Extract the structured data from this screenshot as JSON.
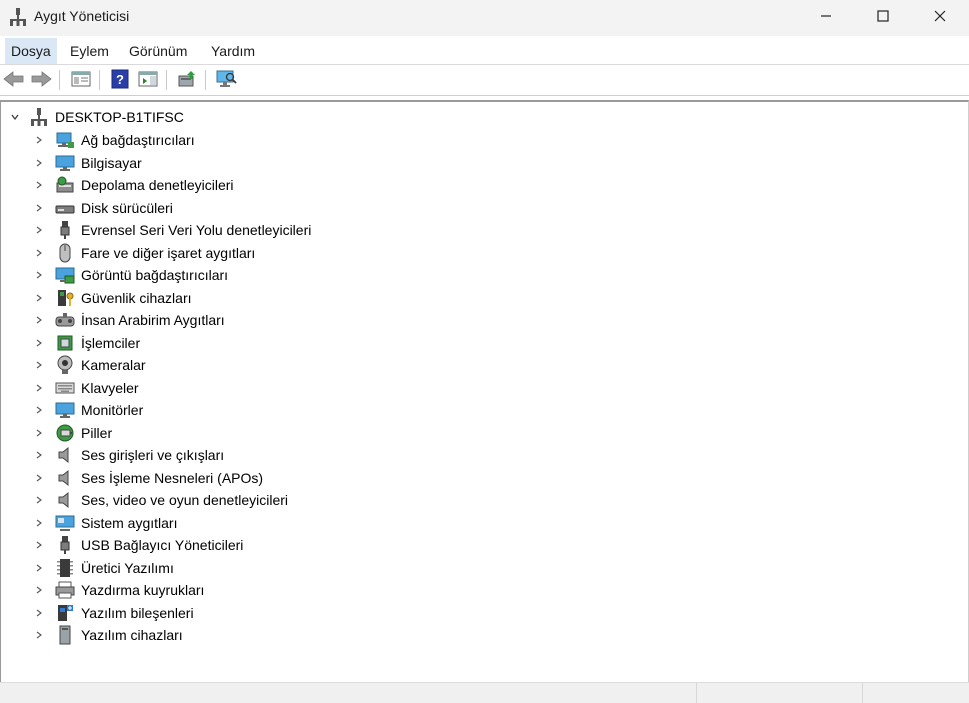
{
  "window": {
    "title": "Aygıt Yöneticisi",
    "controls": [
      "minimize-icon",
      "maximize-icon",
      "close-icon"
    ]
  },
  "menu": {
    "items": [
      "Dosya",
      "Eylem",
      "Görünüm",
      "Yardım"
    ],
    "active": "Dosya"
  },
  "toolbar": {
    "buttons": [
      "back-arrow-icon",
      "forward-arrow-icon",
      "properties-icon",
      "help-icon",
      "action-pane-icon",
      "update-driver-icon",
      "scan-hardware-icon"
    ]
  },
  "tree": {
    "root": "DESKTOP-B1TIFSC",
    "items": [
      {
        "label": "Ağ bağdaştırıcıları",
        "icon": "network-adapter-icon"
      },
      {
        "label": "Bilgisayar",
        "icon": "computer-icon"
      },
      {
        "label": "Depolama denetleyicileri",
        "icon": "storage-controller-icon"
      },
      {
        "label": "Disk sürücüleri",
        "icon": "disk-drive-icon"
      },
      {
        "label": "Evrensel Seri Veri Yolu denetleyicileri",
        "icon": "usb-connector-icon"
      },
      {
        "label": "Fare ve diğer işaret aygıtları",
        "icon": "mouse-icon"
      },
      {
        "label": "Görüntü bağdaştırıcıları",
        "icon": "display-adapter-icon"
      },
      {
        "label": "Güvenlik cihazları",
        "icon": "security-device-icon"
      },
      {
        "label": "İnsan Arabirim Aygıtları",
        "icon": "hid-icon"
      },
      {
        "label": "İşlemciler",
        "icon": "processor-icon"
      },
      {
        "label": "Kameralar",
        "icon": "camera-icon"
      },
      {
        "label": "Klavyeler",
        "icon": "keyboard-icon"
      },
      {
        "label": "Monitörler",
        "icon": "monitor-icon"
      },
      {
        "label": "Piller",
        "icon": "battery-icon"
      },
      {
        "label": "Ses girişleri ve çıkışları",
        "icon": "speaker-icon"
      },
      {
        "label": "Ses İşleme Nesneleri (APOs)",
        "icon": "speaker-icon"
      },
      {
        "label": "Ses, video ve oyun denetleyicileri",
        "icon": "speaker-icon"
      },
      {
        "label": "Sistem aygıtları",
        "icon": "system-device-icon"
      },
      {
        "label": "USB Bağlayıcı Yöneticileri",
        "icon": "usb-connector-icon"
      },
      {
        "label": "Üretici Yazılımı",
        "icon": "firmware-chip-icon"
      },
      {
        "label": "Yazdırma kuyrukları",
        "icon": "printer-icon"
      },
      {
        "label": "Yazılım bileşenleri",
        "icon": "software-component-icon"
      },
      {
        "label": "Yazılım cihazları",
        "icon": "software-device-icon"
      }
    ]
  },
  "colors": {
    "menu_active_bg": "#dae8f5",
    "titlebar_bg": "#f3f3f3",
    "statusbar_bg": "#f0f0f0"
  }
}
